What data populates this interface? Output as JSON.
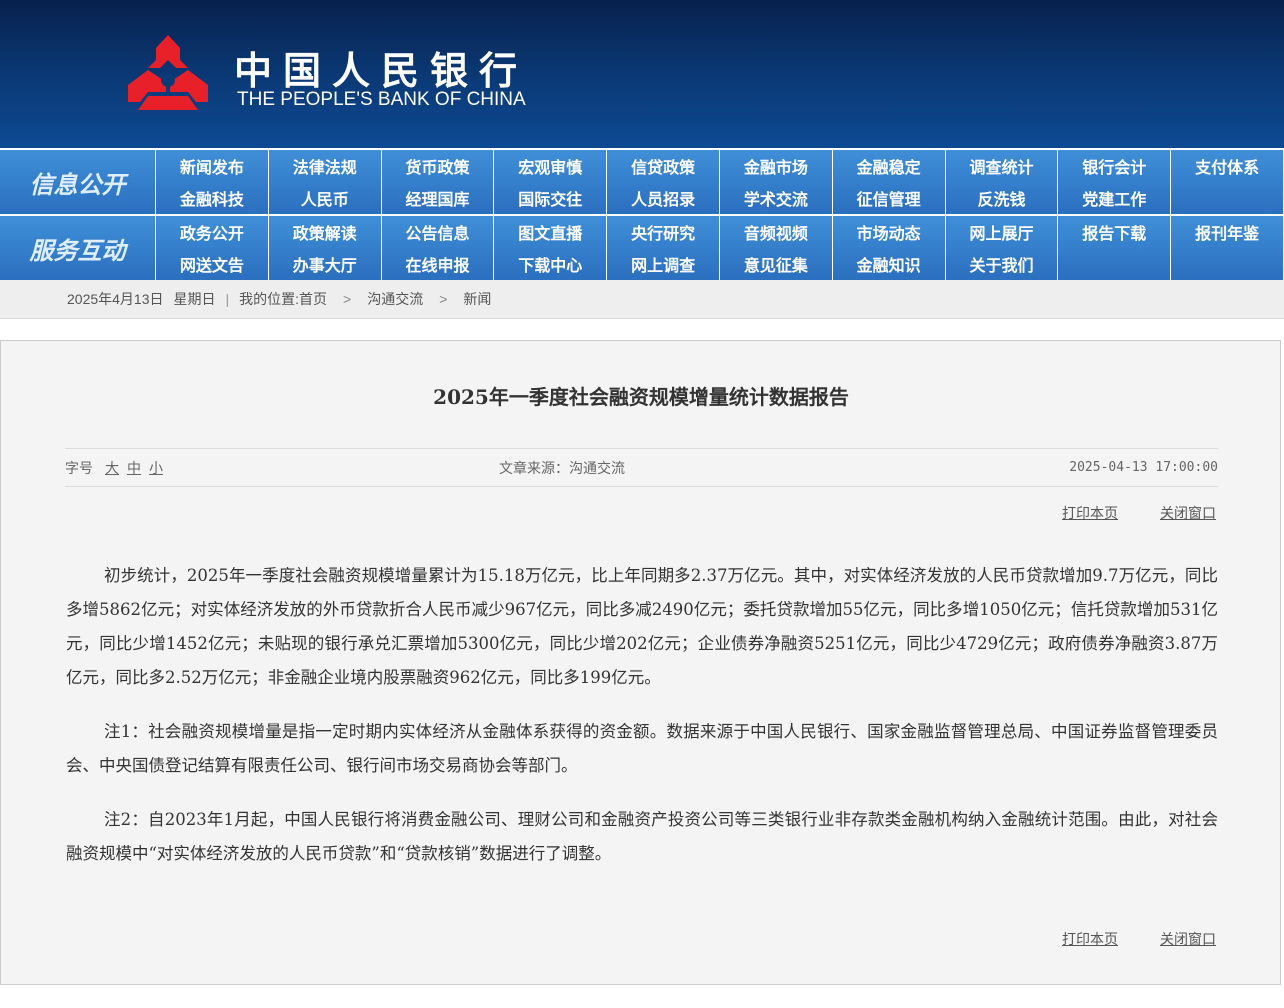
{
  "header": {
    "logo_cn": "中国人民银行",
    "logo_en": "THE PEOPLE'S BANK OF CHINA",
    "emblem_color": "#e8202a"
  },
  "nav": {
    "section1_title": "信息公开",
    "section1_items": [
      "新闻发布",
      "法律法规",
      "货币政策",
      "宏观审慎",
      "信贷政策",
      "金融市场",
      "金融稳定",
      "调查统计",
      "银行会计",
      "支付体系",
      "金融科技",
      "人民币",
      "经理国库",
      "国际交往",
      "人员招录",
      "学术交流",
      "征信管理",
      "反洗钱",
      "党建工作",
      ""
    ],
    "section2_title": "服务互动",
    "section2_items": [
      "政务公开",
      "政策解读",
      "公告信息",
      "图文直播",
      "央行研究",
      "音频视频",
      "市场动态",
      "网上展厅",
      "报告下载",
      "报刊年鉴",
      "网送文告",
      "办事大厅",
      "在线申报",
      "下载中心",
      "网上调查",
      "意见征集",
      "金融知识",
      "关于我们",
      "",
      ""
    ],
    "color": "#2f78c6"
  },
  "breadcrumb": {
    "date": "2025年4月13日",
    "weekday": "星期日",
    "location_label": "我的位置:",
    "home": "首页",
    "level1": "沟通交流",
    "level2": "新闻"
  },
  "article": {
    "title": "2025年一季度社会融资规模增量统计数据报告",
    "font_label": "字号",
    "font_large": "大",
    "font_medium": "中",
    "font_small": "小",
    "source": "文章来源：沟通交流",
    "datetime": "2025-04-13 17:00:00",
    "print_label": "打印本页",
    "close_label": "关闭窗口",
    "paragraphs": [
      "初步统计，2025年一季度社会融资规模增量累计为15.18万亿元，比上年同期多2.37万亿元。其中，对实体经济发放的人民币贷款增加9.7万亿元，同比多增5862亿元；对实体经济发放的外币贷款折合人民币减少967亿元，同比多减2490亿元；委托贷款增加55亿元，同比多增1050亿元；信托贷款增加531亿元，同比少增1452亿元；未贴现的银行承兑汇票增加5300亿元，同比少增202亿元；企业债券净融资5251亿元，同比少4729亿元；政府债券净融资3.87万亿元，同比多2.52万亿元；非金融企业境内股票融资962亿元，同比多199亿元。",
      "注1：社会融资规模增量是指一定时期内实体经济从金融体系获得的资金额。数据来源于中国人民银行、国家金融监督管理总局、中国证券监督管理委员会、中央国债登记结算有限责任公司、银行间市场交易商协会等部门。",
      "注2：自2023年1月起，中国人民银行将消费金融公司、理财公司和金融资产投资公司等三类银行业非存款类金融机构纳入金融统计范围。由此，对社会融资规模中“对实体经济发放的人民币贷款”和“贷款核销”数据进行了调整。"
    ]
  }
}
